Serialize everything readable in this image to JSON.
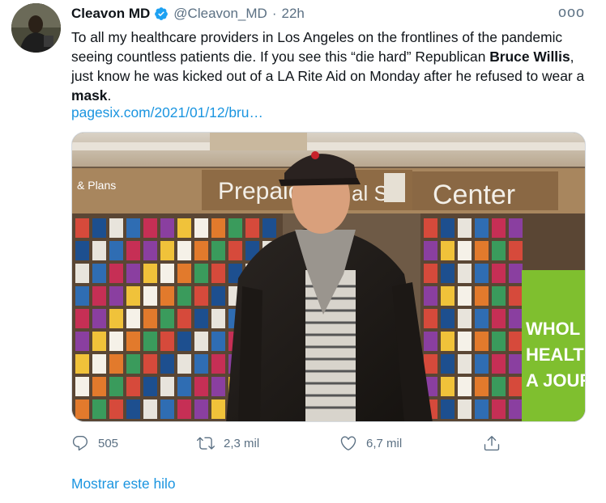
{
  "tweet": {
    "author_name": "Cleavon MD",
    "handle": "@Cleavon_MD",
    "separator": "·",
    "time": "22h",
    "text_1": "To all my healthcare providers in Los Angeles on the frontlines of the pandemic seeing countless patients die. If you see this “die hard” Republican ",
    "bold_1": "Bruce Willis",
    "text_2": ", just know he was kicked out of a LA Rite Aid on Monday after he refused to wear a ",
    "bold_2": "mask",
    "text_3": ".",
    "link": "pagesix.com/2021/01/12/bru…",
    "more_glyph": "ooo"
  },
  "media": {
    "store_sign_left": "Prepaid Ca",
    "store_sign_mid": "al Se",
    "store_sign_right": "Center",
    "small_sign": "& Plans",
    "ad_line_1": "WHOL",
    "ad_line_2": "HEALT",
    "ad_line_3": "A JOUR"
  },
  "actions": {
    "reply_count": "505",
    "retweet_count": "2,3 mil",
    "like_count": "6,7 mil"
  },
  "footer": {
    "show_thread": "Mostrar este hilo"
  },
  "icons": [
    "reply-icon",
    "retweet-icon",
    "like-icon",
    "share-icon",
    "verified-badge-icon",
    "more-options-icon"
  ],
  "colors": {
    "accent": "#1b95e0",
    "secondary_text": "#5b7083",
    "primary_text": "#0f1419"
  }
}
